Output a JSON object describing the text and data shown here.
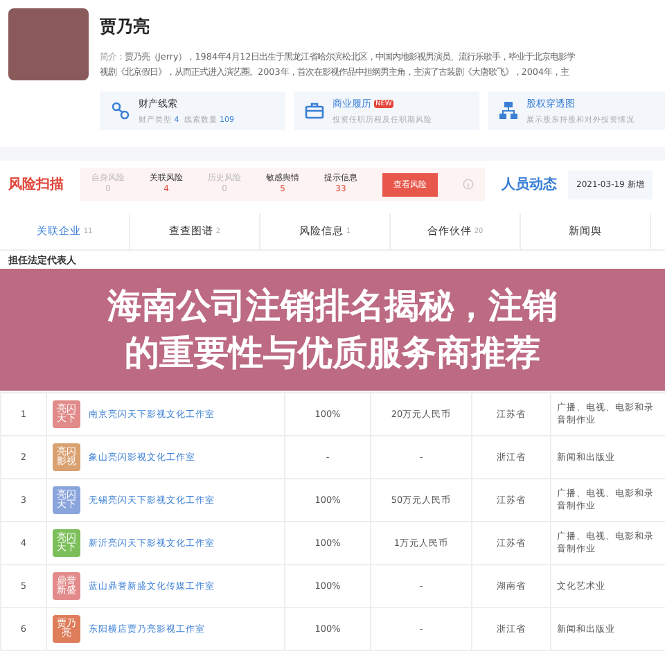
{
  "profile": {
    "name": "贾乃亮",
    "intro_label": "简介：",
    "intro_lines": [
      "贾乃亮（Jerry），1984年4月12日出生于黑龙江省哈尔滨松北区，中国内地影视男演员、流行乐歌手，毕业于北京电影学",
      "视剧《北京假日》，从而正式进入演艺圈。2003年，首次在影视作品中担纲男主角，主演了古装剧《大唐歌飞》，2004年，主"
    ]
  },
  "cards": [
    {
      "kind": "assets",
      "title": "财产线索",
      "sub": [
        {
          "label": "财产类型",
          "value": "4"
        },
        {
          "label": "线索数量",
          "value": "109"
        }
      ]
    },
    {
      "kind": "career",
      "title": "商业履历",
      "badge": "NEW",
      "desc": "投资任职历程及任职期风险"
    },
    {
      "kind": "equity",
      "title": "股权穿透图",
      "desc": "展示股东持股和对外投资情况"
    }
  ],
  "risk_scan": {
    "logo": "风险扫描",
    "items": [
      {
        "label": "自身风险",
        "count": "0",
        "muted": true
      },
      {
        "label": "关联风险",
        "count": "4",
        "muted": false
      },
      {
        "label": "历史风险",
        "count": "0",
        "muted": true
      },
      {
        "label": "敏感舆情",
        "count": "5",
        "muted": false
      },
      {
        "label": "提示信息",
        "count": "33",
        "muted": false
      }
    ],
    "button": "查看风险",
    "news_logo": "人员动态",
    "news_text": "2021-03-19 新增"
  },
  "tabs": [
    {
      "label": "关联企业",
      "count": "11",
      "selected": true
    },
    {
      "label": "查查图谱",
      "count": "2",
      "selected": false
    },
    {
      "label": "风险信息",
      "count": "1",
      "selected": false
    },
    {
      "label": "合作伙伴",
      "count": "20",
      "selected": false
    },
    {
      "label": "新闻舆",
      "selected": false
    }
  ],
  "section": {
    "title": "担任法定代表人"
  },
  "table": {
    "rows": [
      {
        "index": "1",
        "logo": {
          "text": "亮闪天下",
          "color": "#e08a8a"
        },
        "name": "南京亮闪天下影视文化工作室",
        "share": "100%",
        "capital": "20万元人民币",
        "province": "江苏省",
        "industry": "广播、电视、电影和录音制作业"
      },
      {
        "index": "2",
        "logo": {
          "text": "亮闪影视",
          "color": "#d9a070"
        },
        "name": "象山亮闪影视文化工作室",
        "share": "-",
        "capital": "-",
        "province": "浙江省",
        "industry": "新闻和出版业"
      },
      {
        "index": "3",
        "logo": {
          "text": "亮闪天下",
          "color": "#8aa4dc"
        },
        "name": "无锡亮闪天下影视文化工作室",
        "share": "100%",
        "capital": "50万元人民币",
        "province": "江苏省",
        "industry": "广播、电视、电影和录音制作业"
      },
      {
        "index": "4",
        "logo": {
          "text": "亮闪天下",
          "color": "#7cbf5a"
        },
        "name": "新沂亮闪天下影视文化工作室",
        "share": "100%",
        "capital": "1万元人民币",
        "province": "江苏省",
        "industry": "广播、电视、电影和录音制作业"
      },
      {
        "index": "5",
        "logo": {
          "text": "鼎誉新盛",
          "color": "#e38a8a"
        },
        "name": "蓝山鼎誉新盛文化传媒工作室",
        "share": "100%",
        "capital": "-",
        "province": "湖南省",
        "industry": "文化艺术业"
      },
      {
        "index": "6",
        "logo": {
          "text": "贾乃亮",
          "color": "#de7d5a"
        },
        "name": "东阳横店贾乃亮影视工作室",
        "share": "100%",
        "capital": "-",
        "province": "浙江省",
        "industry": "新闻和出版业"
      }
    ]
  },
  "banner": {
    "lines": [
      "海南公司注销排名揭秘，注销",
      "的重要性与优质服务商推荐"
    ]
  }
}
